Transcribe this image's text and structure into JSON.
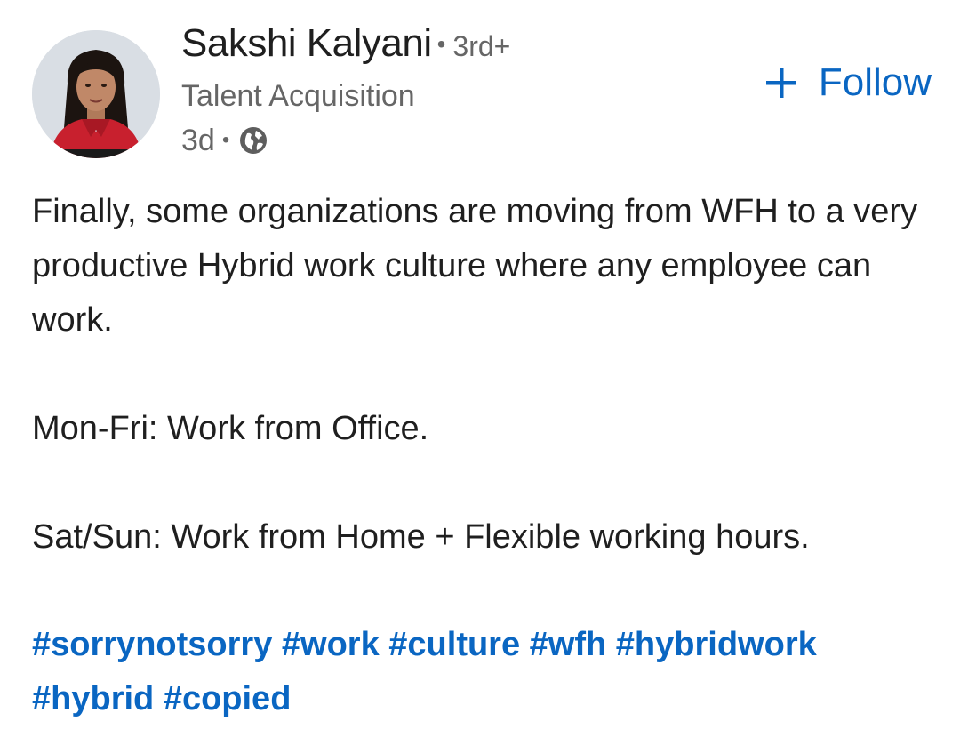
{
  "author": {
    "name": "Sakshi Kalyani",
    "separator": "•",
    "connection_degree": "3rd+",
    "headline": "Talent Acquisition",
    "time_ago": "3d",
    "visibility_separator": "•",
    "visibility_icon": "globe-icon"
  },
  "follow": {
    "label": "Follow",
    "icon": "plus-icon",
    "color": "#0a66c2"
  },
  "post": {
    "paragraphs": [
      "Finally, some organizations are moving from WFH to a very productive Hybrid work culture where any employee can work.",
      "Mon-Fri: Work from Office.",
      "Sat/Sun: Work from Home + Flexible working hours."
    ],
    "hashtags": [
      "#sorrynotsorry",
      "#work",
      "#culture",
      "#wfh",
      "#hybridwork",
      "#hybrid",
      "#copied"
    ]
  },
  "colors": {
    "link": "#0a66c2",
    "text": "#1f1f1f",
    "muted": "#666666"
  }
}
